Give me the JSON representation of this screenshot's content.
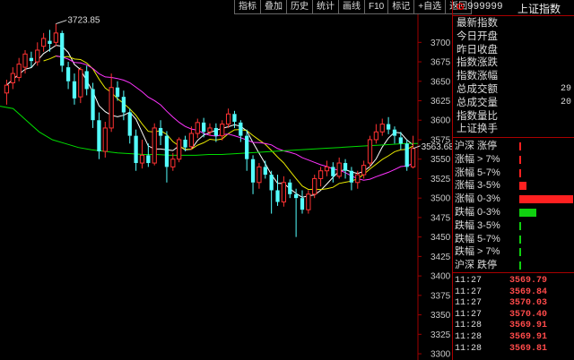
{
  "toolbar": {
    "buttons": [
      "指标",
      "叠加",
      "历史",
      "统计",
      "画线",
      "F10",
      "标记",
      "+自选",
      "返回"
    ]
  },
  "chart_data": {
    "type": "candlestick",
    "y_axis": {
      "ticks": [
        3700,
        3675,
        3650,
        3625,
        3600,
        3575,
        3550,
        3525,
        3500,
        3475,
        3450,
        3425,
        3400,
        3375,
        3350,
        3325,
        3300
      ],
      "range": [
        3292,
        3736
      ]
    },
    "high_annotation": {
      "label": "3723.85",
      "value": 3723.85
    },
    "current_annotation": {
      "label": "3563.68",
      "value": 3563.68
    },
    "candles": [
      {
        "o": 3635,
        "c": 3645,
        "h": 3652,
        "l": 3620
      },
      {
        "o": 3648,
        "c": 3660,
        "h": 3668,
        "l": 3640
      },
      {
        "o": 3655,
        "c": 3672,
        "h": 3680,
        "l": 3650
      },
      {
        "o": 3668,
        "c": 3685,
        "h": 3690,
        "l": 3660
      },
      {
        "o": 3680,
        "c": 3676,
        "h": 3688,
        "l": 3668
      },
      {
        "o": 3675,
        "c": 3690,
        "h": 3700,
        "l": 3670
      },
      {
        "o": 3695,
        "c": 3705,
        "h": 3712,
        "l": 3688
      },
      {
        "o": 3702,
        "c": 3698,
        "h": 3716,
        "l": 3688
      },
      {
        "o": 3700,
        "c": 3712,
        "h": 3723.85,
        "l": 3695
      },
      {
        "o": 3712,
        "c": 3670,
        "h": 3715,
        "l": 3662
      },
      {
        "o": 3668,
        "c": 3650,
        "h": 3675,
        "l": 3640
      },
      {
        "o": 3650,
        "c": 3628,
        "h": 3660,
        "l": 3620
      },
      {
        "o": 3630,
        "c": 3665,
        "h": 3668,
        "l": 3622
      },
      {
        "o": 3663,
        "c": 3640,
        "h": 3670,
        "l": 3632
      },
      {
        "o": 3640,
        "c": 3600,
        "h": 3648,
        "l": 3590
      },
      {
        "o": 3600,
        "c": 3560,
        "h": 3610,
        "l": 3550
      },
      {
        "o": 3560,
        "c": 3590,
        "h": 3598,
        "l": 3552
      },
      {
        "o": 3590,
        "c": 3642,
        "h": 3660,
        "l": 3585
      },
      {
        "o": 3642,
        "c": 3630,
        "h": 3650,
        "l": 3625
      },
      {
        "o": 3630,
        "c": 3610,
        "h": 3638,
        "l": 3600
      },
      {
        "o": 3610,
        "c": 3580,
        "h": 3615,
        "l": 3570
      },
      {
        "o": 3580,
        "c": 3545,
        "h": 3588,
        "l": 3535
      },
      {
        "o": 3545,
        "c": 3555,
        "h": 3575,
        "l": 3538
      },
      {
        "o": 3555,
        "c": 3545,
        "h": 3570,
        "l": 3540
      },
      {
        "o": 3545,
        "c": 3590,
        "h": 3596,
        "l": 3542
      },
      {
        "o": 3590,
        "c": 3580,
        "h": 3600,
        "l": 3568
      },
      {
        "o": 3580,
        "c": 3540,
        "h": 3586,
        "l": 3520
      },
      {
        "o": 3540,
        "c": 3550,
        "h": 3558,
        "l": 3535
      },
      {
        "o": 3550,
        "c": 3575,
        "h": 3578,
        "l": 3546
      },
      {
        "o": 3575,
        "c": 3565,
        "h": 3580,
        "l": 3560
      },
      {
        "o": 3566,
        "c": 3583,
        "h": 3592,
        "l": 3562
      },
      {
        "o": 3583,
        "c": 3597,
        "h": 3602,
        "l": 3577
      },
      {
        "o": 3597,
        "c": 3585,
        "h": 3603,
        "l": 3578
      },
      {
        "o": 3585,
        "c": 3590,
        "h": 3596,
        "l": 3580
      },
      {
        "o": 3590,
        "c": 3580,
        "h": 3596,
        "l": 3572
      },
      {
        "o": 3580,
        "c": 3595,
        "h": 3600,
        "l": 3574
      },
      {
        "o": 3595,
        "c": 3608,
        "h": 3615,
        "l": 3590
      },
      {
        "o": 3608,
        "c": 3598,
        "h": 3612,
        "l": 3590
      },
      {
        "o": 3597,
        "c": 3580,
        "h": 3600,
        "l": 3572
      },
      {
        "o": 3580,
        "c": 3550,
        "h": 3588,
        "l": 3535
      },
      {
        "o": 3550,
        "c": 3520,
        "h": 3555,
        "l": 3505
      },
      {
        "o": 3520,
        "c": 3540,
        "h": 3545,
        "l": 3512
      },
      {
        "o": 3540,
        "c": 3530,
        "h": 3548,
        "l": 3525
      },
      {
        "o": 3530,
        "c": 3510,
        "h": 3535,
        "l": 3480
      },
      {
        "o": 3510,
        "c": 3495,
        "h": 3530,
        "l": 3490
      },
      {
        "o": 3495,
        "c": 3520,
        "h": 3528,
        "l": 3489
      },
      {
        "o": 3520,
        "c": 3505,
        "h": 3524,
        "l": 3500
      },
      {
        "o": 3505,
        "c": 3500,
        "h": 3512,
        "l": 3450
      },
      {
        "o": 3500,
        "c": 3485,
        "h": 3510,
        "l": 3480
      },
      {
        "o": 3485,
        "c": 3505,
        "h": 3510,
        "l": 3480
      },
      {
        "o": 3505,
        "c": 3525,
        "h": 3530,
        "l": 3500
      },
      {
        "o": 3525,
        "c": 3535,
        "h": 3540,
        "l": 3515
      },
      {
        "o": 3535,
        "c": 3540,
        "h": 3548,
        "l": 3528
      },
      {
        "o": 3540,
        "c": 3528,
        "h": 3546,
        "l": 3520
      },
      {
        "o": 3528,
        "c": 3545,
        "h": 3552,
        "l": 3525
      },
      {
        "o": 3545,
        "c": 3535,
        "h": 3550,
        "l": 3525
      },
      {
        "o": 3535,
        "c": 3520,
        "h": 3540,
        "l": 3510
      },
      {
        "o": 3520,
        "c": 3530,
        "h": 3535,
        "l": 3512
      },
      {
        "o": 3530,
        "c": 3542,
        "h": 3548,
        "l": 3525
      },
      {
        "o": 3545,
        "c": 3575,
        "h": 3580,
        "l": 3540
      },
      {
        "o": 3575,
        "c": 3585,
        "h": 3595,
        "l": 3570
      },
      {
        "o": 3585,
        "c": 3595,
        "h": 3602,
        "l": 3580
      },
      {
        "o": 3595,
        "c": 3588,
        "h": 3604,
        "l": 3582
      },
      {
        "o": 3588,
        "c": 3580,
        "h": 3592,
        "l": 3570
      },
      {
        "o": 3578,
        "c": 3570,
        "h": 3585,
        "l": 3562
      },
      {
        "o": 3570,
        "c": 3540,
        "h": 3575,
        "l": 3535
      },
      {
        "o": 3540,
        "c": 3563.68,
        "h": 3580,
        "l": 3538
      }
    ],
    "moving_averages": [
      {
        "name": "MA5",
        "color": "#ffffff",
        "period": 5
      },
      {
        "name": "MA10",
        "color": "#e8e800",
        "period": 10
      },
      {
        "name": "MA20",
        "color": "#ff33ff",
        "period": 20
      },
      {
        "name": "MA60",
        "color": "#00dd00",
        "values_start": 3618,
        "values": [
          3618,
          3615,
          3600,
          3585,
          3575,
          3570,
          3565,
          3562,
          3560,
          3558,
          3557,
          3556,
          3556,
          3555,
          3555,
          3555,
          3556,
          3556,
          3557,
          3558,
          3559,
          3560,
          3561,
          3562,
          3563,
          3564,
          3565,
          3566,
          3567,
          3568,
          3569,
          3570,
          3570
        ]
      }
    ],
    "colors": {
      "up": "#ff3232",
      "down": "#54ffff",
      "axis": "#a00000",
      "axis_label": "#c8c8c8"
    }
  },
  "panel": {
    "header": {
      "g": "G",
      "code": "999999",
      "name": "上证指数"
    },
    "info": [
      {
        "label": "最新指数",
        "value": ""
      },
      {
        "label": "今日开盘",
        "value": ""
      },
      {
        "label": "昨日收盘",
        "value": ""
      },
      {
        "label": "指数涨跌",
        "value": ""
      },
      {
        "label": "指数涨幅",
        "value": ""
      },
      {
        "label": "总成交额",
        "value": "29"
      },
      {
        "label": "总成交量",
        "value": "20"
      },
      {
        "label": "指数量比",
        "value": ""
      },
      {
        "label": "上证换手",
        "value": ""
      }
    ],
    "distribution": [
      {
        "label": "沪深 涨停",
        "fraction": 0.008,
        "color": "#ff2020"
      },
      {
        "label": "涨幅 > 7%",
        "fraction": 0.008,
        "color": "#ff2020"
      },
      {
        "label": "涨幅 5-7%",
        "fraction": 0.03,
        "color": "#ff2020"
      },
      {
        "label": "涨幅 3-5%",
        "fraction": 0.13,
        "color": "#ff2020"
      },
      {
        "label": "涨幅 0-3%",
        "fraction": 1.0,
        "color": "#ff2020"
      },
      {
        "label": "跌幅 0-3%",
        "fraction": 0.32,
        "color": "#10d010"
      },
      {
        "label": "跌幅 3-5%",
        "fraction": 0.01,
        "color": "#10d010"
      },
      {
        "label": "跌幅 5-7%",
        "fraction": 0.008,
        "color": "#10d010"
      },
      {
        "label": "跌幅 > 7%",
        "fraction": 0.008,
        "color": "#10d010"
      },
      {
        "label": "沪深 跌停",
        "fraction": 0.006,
        "color": "#10d010"
      }
    ],
    "ticks": [
      {
        "time": "11:27",
        "price": "3569.79"
      },
      {
        "time": "11:27",
        "price": "3569.84"
      },
      {
        "time": "11:27",
        "price": "3570.03"
      },
      {
        "time": "11:27",
        "price": "3570.40"
      },
      {
        "time": "11:28",
        "price": "3569.91"
      },
      {
        "time": "11:28",
        "price": "3569.91"
      },
      {
        "time": "11:28",
        "price": "3569.81"
      }
    ]
  }
}
